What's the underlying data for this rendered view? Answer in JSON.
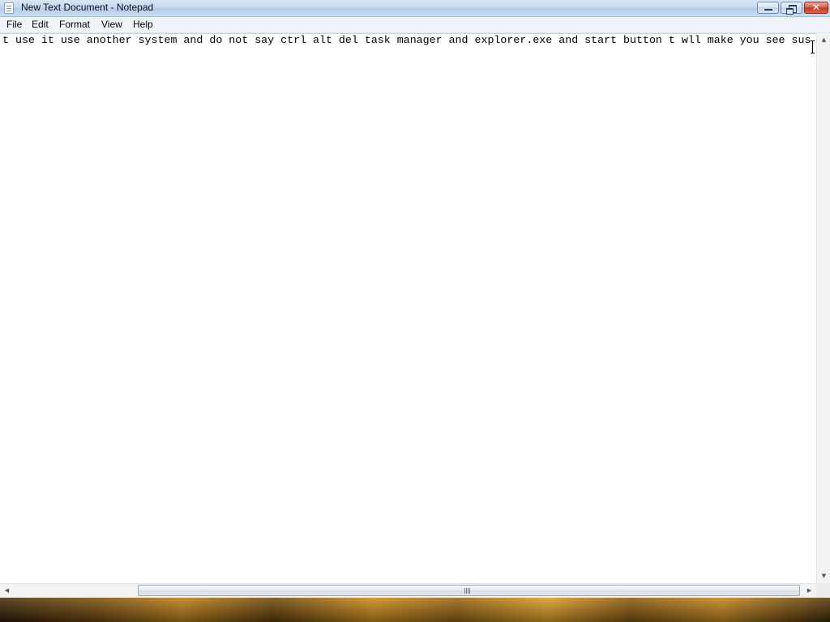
{
  "window": {
    "title": "New Text Document - Notepad",
    "close_symbol": "✕"
  },
  "menu": {
    "items": [
      "File",
      "Edit",
      "Format",
      "View",
      "Help"
    ]
  },
  "editor": {
    "text": "t use it use another system and do not say ctrl alt del task manager and explorer.exe and start button t wll make you see sus"
  },
  "scrollbars": {
    "up_arrow": "▲",
    "down_arrow": "▼",
    "left_arrow": "◀",
    "right_arrow": "▶"
  },
  "icons": [
    "notepad-app-icon",
    "minimize-icon",
    "maximize-icon",
    "close-icon",
    "text-cursor-icon",
    "scroll-arrow-icons"
  ],
  "colors": {
    "title_bar": "#c2d6ee",
    "close_button": "#c9391e",
    "editor_background": "#ffffff"
  }
}
